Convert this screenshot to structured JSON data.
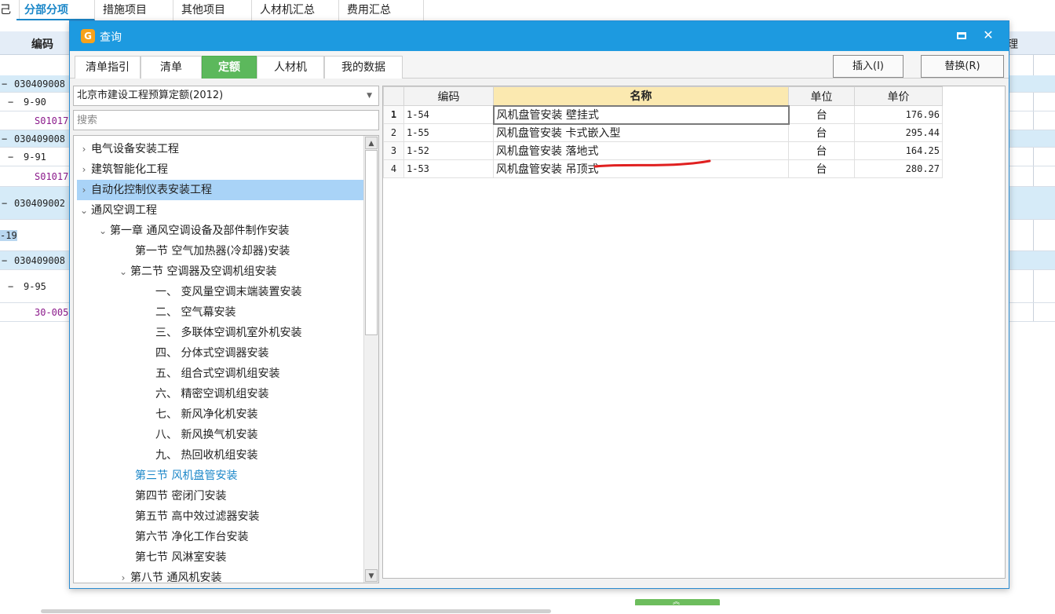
{
  "app": {
    "tabs": [
      {
        "label": "分部分项",
        "active": true
      },
      {
        "label": "措施项目"
      },
      {
        "label": "其他项目"
      },
      {
        "label": "人材机汇总"
      },
      {
        "label": "费用汇总"
      }
    ],
    "first_tab_fragment": "己",
    "header_code": "编码",
    "header_right": "理",
    "rows": [
      {
        "toggle": "−",
        "code": "030409008"
      },
      {
        "toggle": "−",
        "code": "9-90"
      },
      {
        "code": "S01017"
      },
      {
        "toggle": "−",
        "code": "030409008"
      },
      {
        "toggle": "−",
        "code": "9-91"
      },
      {
        "code": "S01017"
      },
      {
        "toggle": "−",
        "code": "030409002"
      },
      {
        "code": "-19"
      },
      {
        "toggle": "−",
        "code": "030409008"
      },
      {
        "toggle": "−",
        "code": "9-95"
      },
      {
        "code": "30-005"
      }
    ]
  },
  "dialog": {
    "title": "查询",
    "tabs": [
      "清单指引",
      "清单",
      "定额",
      "人材机",
      "我的数据"
    ],
    "active_tab": "定额",
    "buttons": {
      "insert": "插入(I)",
      "replace": "替换(R)"
    },
    "quota_select": "北京市建设工程预算定额(2012)",
    "search_placeholder": "搜索",
    "tree": [
      {
        "label": "电气设备安装工程",
        "arrow": "›"
      },
      {
        "label": "建筑智能化工程",
        "arrow": "›"
      },
      {
        "label": "自动化控制仪表安装工程",
        "arrow": "›"
      },
      {
        "label": "通风空调工程",
        "arrow": "⌄"
      },
      {
        "label": "第一章 通风空调设备及部件制作安装",
        "arrow": "⌄"
      },
      {
        "label": "第一节 空气加热器(冷却器)安装"
      },
      {
        "label": "第二节 空调器及空调机组安装",
        "arrow": "⌄"
      },
      {
        "label": "一、 变风量空调末端装置安装"
      },
      {
        "label": "二、 空气幕安装"
      },
      {
        "label": "三、 多联体空调机室外机安装"
      },
      {
        "label": "四、 分体式空调器安装"
      },
      {
        "label": "五、 组合式空调机组安装"
      },
      {
        "label": "六、 精密空调机组安装"
      },
      {
        "label": "七、 新风净化机安装"
      },
      {
        "label": "八、 新风换气机安装"
      },
      {
        "label": "九、 热回收机组安装"
      },
      {
        "label": "第三节 风机盘管安装"
      },
      {
        "label": "第四节 密闭门安装"
      },
      {
        "label": "第五节 高中效过滤器安装"
      },
      {
        "label": "第六节 净化工作台安装"
      },
      {
        "label": "第七节 风淋室安装"
      },
      {
        "label": "第八节 通风机安装",
        "arrow": "›"
      }
    ],
    "table": {
      "headers": [
        "编码",
        "名称",
        "单位",
        "单价"
      ],
      "rows": [
        {
          "no": "1",
          "code": "1-54",
          "name": "风机盘管安装 壁挂式",
          "unit": "台",
          "price": "176.96"
        },
        {
          "no": "2",
          "code": "1-55",
          "name": "风机盘管安装 卡式嵌入型",
          "unit": "台",
          "price": "295.44"
        },
        {
          "no": "3",
          "code": "1-52",
          "name": "风机盘管安装 落地式",
          "unit": "台",
          "price": "164.25"
        },
        {
          "no": "4",
          "code": "1-53",
          "name": "风机盘管安装 吊顶式",
          "unit": "台",
          "price": "280.27"
        }
      ]
    },
    "colors": {
      "titlebar": "#1d9ae0",
      "active_tab": "#5cb85c",
      "selected_tree": "#a9d3f7",
      "link": "#1a86c8"
    }
  }
}
